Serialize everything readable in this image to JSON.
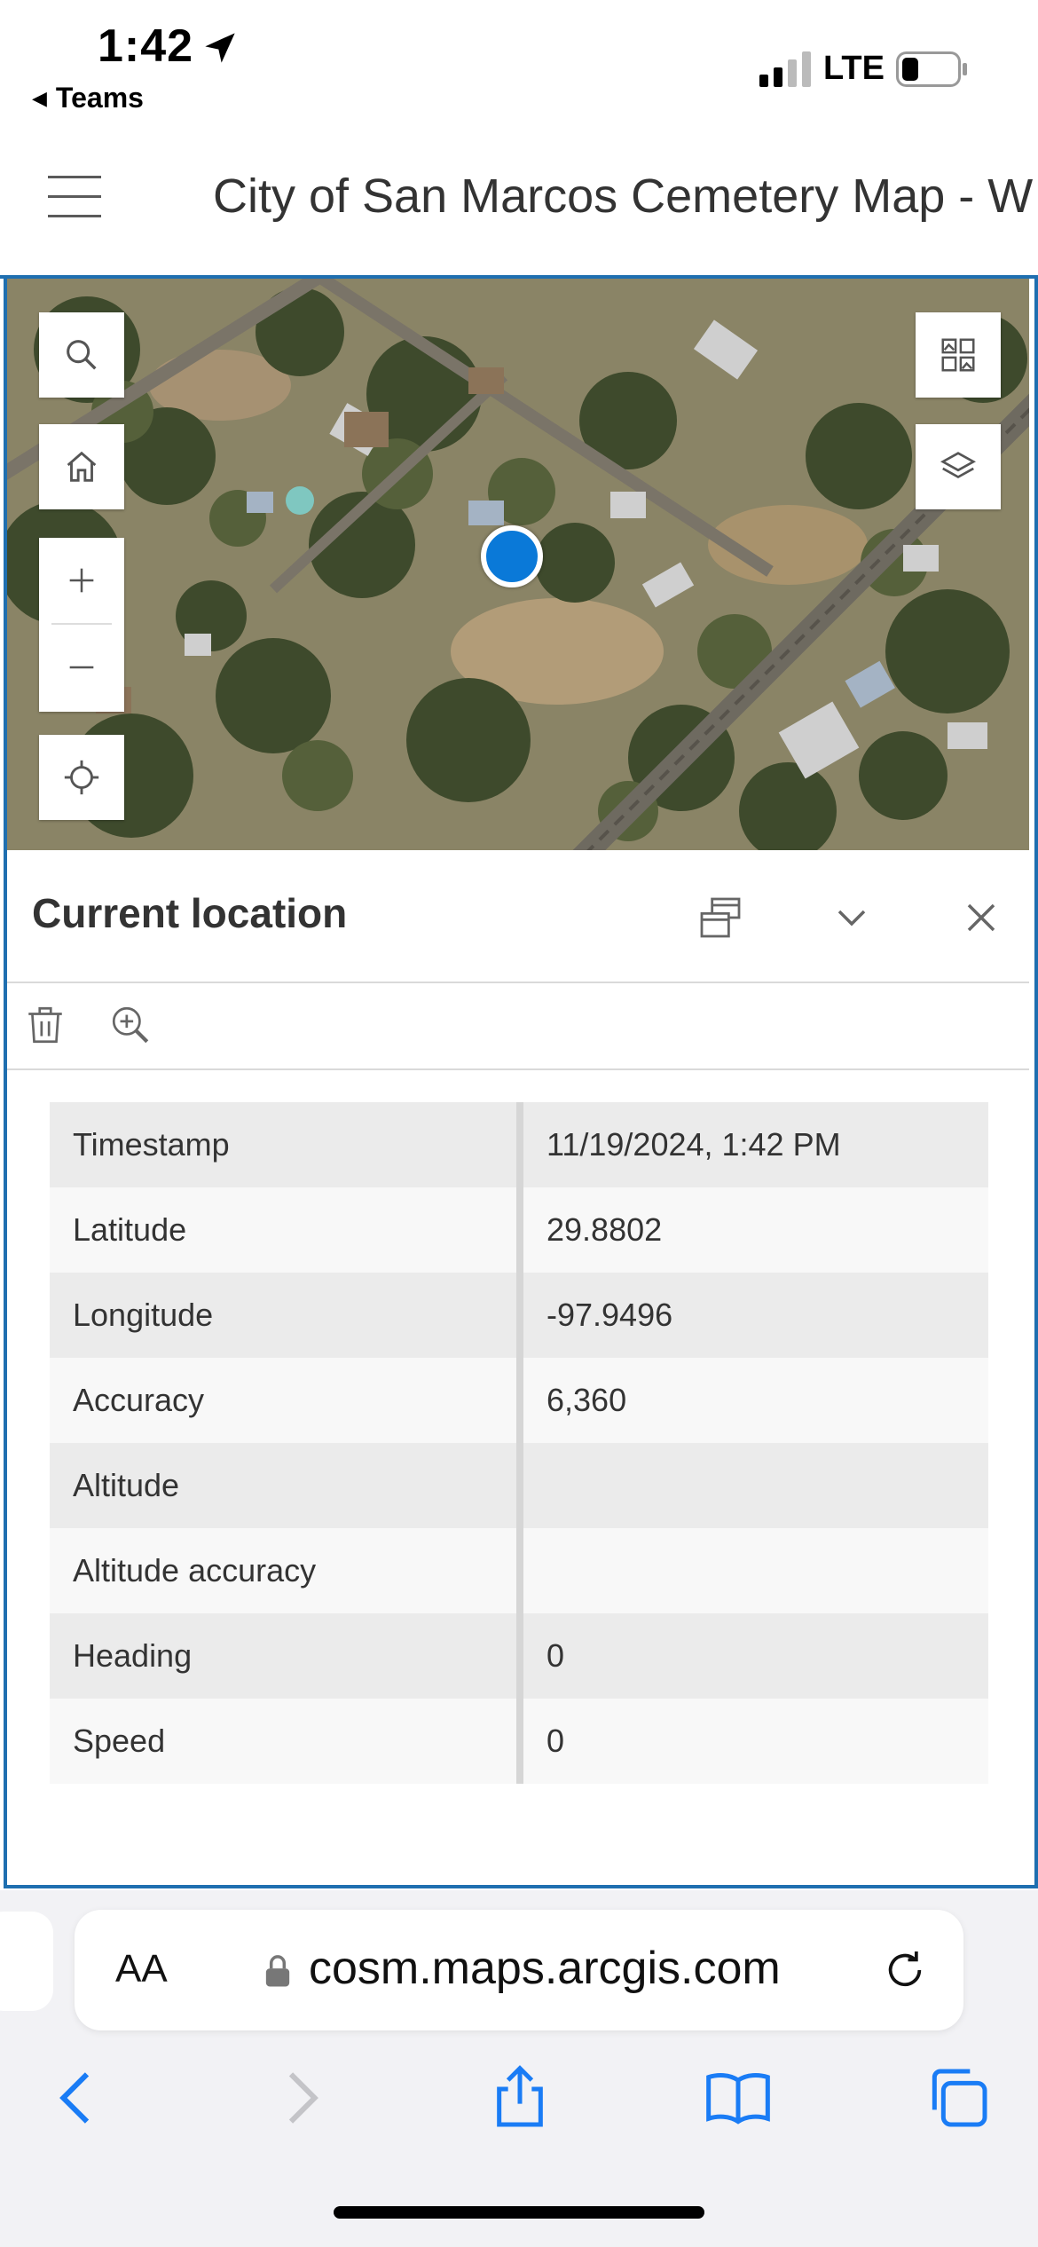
{
  "status_bar": {
    "time": "1:42",
    "back_app": "Teams",
    "network": "LTE"
  },
  "header": {
    "title": "City of San Marcos Cemetery Map - W"
  },
  "map": {
    "basemap": "imagery",
    "controls": [
      "search-icon",
      "home-icon",
      "zoom-in-icon",
      "zoom-out-icon",
      "locate-icon",
      "basemap-gallery-icon",
      "layers-icon"
    ]
  },
  "popup": {
    "title": "Current location",
    "fields": [
      {
        "label": "Timestamp",
        "value": "11/19/2024, 1:42 PM"
      },
      {
        "label": "Latitude",
        "value": "29.8802"
      },
      {
        "label": "Longitude",
        "value": "-97.9496"
      },
      {
        "label": "Accuracy",
        "value": "6,360"
      },
      {
        "label": "Altitude",
        "value": ""
      },
      {
        "label": "Altitude accuracy",
        "value": ""
      },
      {
        "label": "Heading",
        "value": "0"
      },
      {
        "label": "Speed",
        "value": "0"
      }
    ]
  },
  "browser": {
    "text_size": "AA",
    "url": "cosm.maps.arcgis.com"
  },
  "colors": {
    "accent": "#1f6fb0",
    "location_dot": "#0a79d8",
    "ios_blue": "#1a7cf5"
  }
}
